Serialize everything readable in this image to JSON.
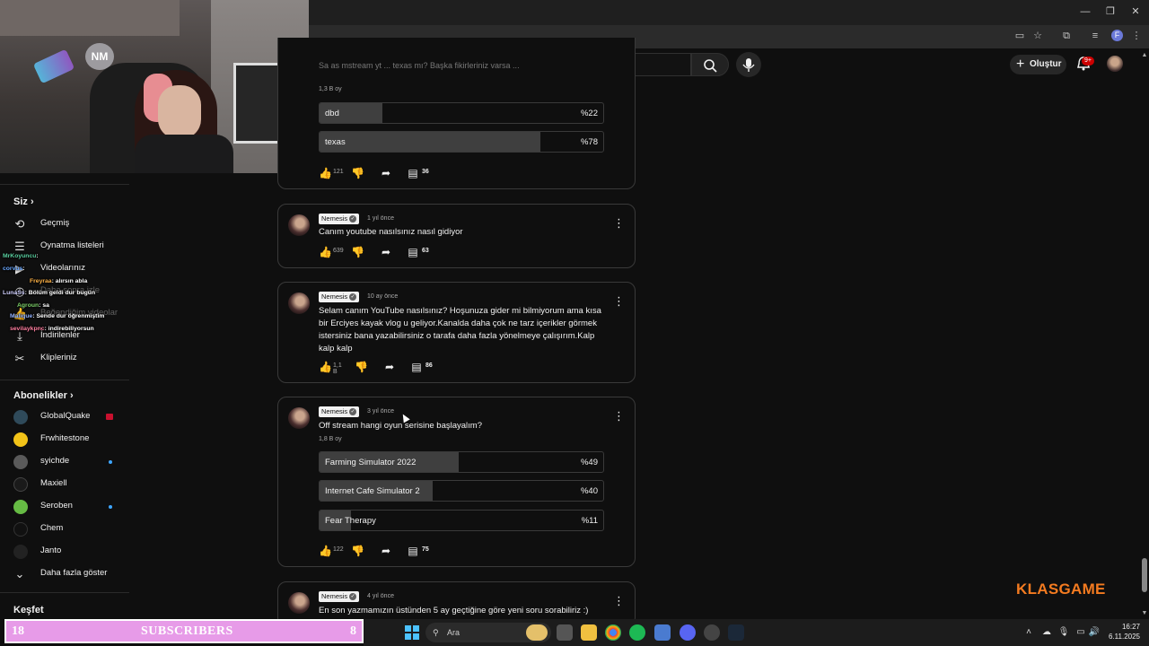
{
  "search": {
    "placeholder": "Ara"
  },
  "header": {
    "create_label": "Oluştur",
    "notif_badge": "9+"
  },
  "sidebar": {
    "you_heading": "Siz",
    "you_items": [
      {
        "label": "Geçmiş",
        "icon": "history-icon"
      },
      {
        "label": "Oynatma listeleri",
        "icon": "playlists-icon"
      },
      {
        "label": "Videolarınız",
        "icon": "your-videos-icon"
      },
      {
        "label": "Daha sonra izle",
        "icon": "watch-later-icon"
      },
      {
        "label": "Beğendiğim videolar",
        "icon": "liked-videos-icon"
      },
      {
        "label": "İndirilenler",
        "icon": "downloads-icon"
      },
      {
        "label": "Klipleriniz",
        "icon": "clips-icon"
      }
    ],
    "subs_heading": "Abonelikler",
    "subscriptions": [
      {
        "name": "GlobalQuake",
        "color": "#2f4a5a",
        "indicator": "live"
      },
      {
        "name": "Frwhitestone",
        "color": "#f2c318",
        "indicator": ""
      },
      {
        "name": "syichde",
        "color": "#5a5a5a",
        "indicator": "dot"
      },
      {
        "name": "Maxiell",
        "color": "#1a1a1a",
        "indicator": ""
      },
      {
        "name": "Seroben",
        "color": "#66bb44",
        "indicator": "dot"
      },
      {
        "name": "Chem",
        "color": "#111111",
        "indicator": ""
      },
      {
        "name": "Janto",
        "color": "#222222",
        "indicator": ""
      }
    ],
    "show_more": "Daha fazla göster",
    "explore_heading": "Keşfet"
  },
  "chat": [
    {
      "user": "MrKoyuncu",
      "msg": ": ",
      "color": "#5ad0a0"
    },
    {
      "user": "corvus",
      "msg": ": ",
      "color": "#6aa8ff"
    },
    {
      "user": "Freyraa",
      "msg": ": alırsın abla",
      "color": "#ffb347"
    },
    {
      "user": "LunaSs",
      "msg": ": Bölüm geldi dur bugün",
      "color": "#d0d0ff"
    },
    {
      "user": "Agroun",
      "msg": ": sa",
      "color": "#7fd36b"
    },
    {
      "user": "Malique",
      "msg": ": Sende dur öğrenmiştim",
      "color": "#8fb0ff"
    },
    {
      "user": "sevilaykpnc",
      "msg": ": indirebiliyorsun",
      "color": "#ff7fa0"
    }
  ],
  "posts": [
    {
      "text": "Sa as mstream yt ... texas mı? Başka fikirleriniz varsa ...",
      "votes": "1,3 B oy",
      "options": [
        {
          "label": "dbd",
          "pct": "%22",
          "value": 22
        },
        {
          "label": "texas",
          "pct": "%78",
          "value": 78
        }
      ],
      "likes": "121",
      "comments": "36"
    },
    {
      "author": "Nemesis",
      "time": "1 yıl önce",
      "text": "Canım youtube nasılsınız nasıl gidiyor",
      "likes": "639",
      "comments": "63"
    },
    {
      "author": "Nemesis",
      "time": "10 ay önce",
      "text": "Selam canım YouTube nasılsınız? Hoşunuza gider mi bilmiyorum ama kısa bir Erciyes kayak vlog u geliyor.Kanalda daha çok ne tarz içerikler görmek istersiniz bana yazabilirsiniz o tarafa daha fazla yönelmeye çalışırım.Kalp kalp kalp",
      "likes": "1,1 B",
      "comments": "86"
    },
    {
      "author": "Nemesis",
      "time": "3 yıl önce",
      "text": "Off stream hangi oyun serisine başlayalım?",
      "votes": "1,8 B oy",
      "options": [
        {
          "label": "Farming Simulator 2022",
          "pct": "%49",
          "value": 49
        },
        {
          "label": "Internet Cafe Simulator 2",
          "pct": "%40",
          "value": 40
        },
        {
          "label": "Fear Therapy",
          "pct": "%11",
          "value": 11
        }
      ],
      "likes": "122",
      "comments": "75"
    },
    {
      "author": "Nemesis",
      "time": "4 yıl önce",
      "text": "En son yazmamızın üstünden 5 ay geçtiğine göre yeni soru sorabiliriz :)"
    }
  ],
  "brand": "KLASGAME",
  "subs_bar": {
    "left": "18",
    "label": "SUBSCRIBERS",
    "right": "8"
  },
  "taskbar": {
    "search": "Ara",
    "time": "16:27",
    "date": "6.11.2025"
  }
}
